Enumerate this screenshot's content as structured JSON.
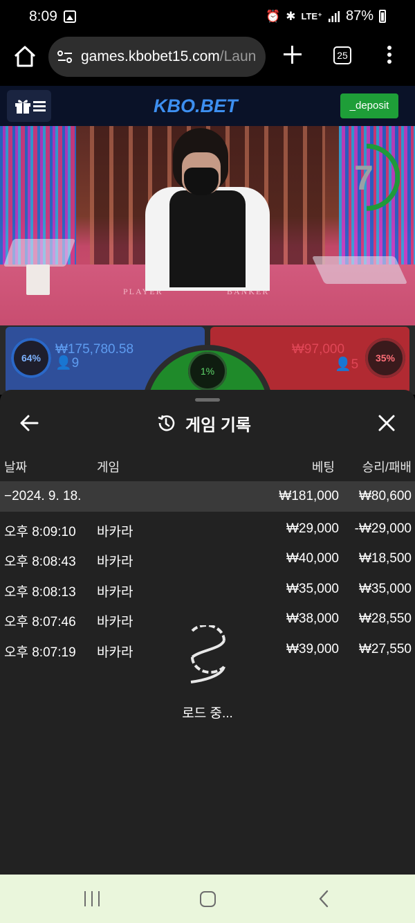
{
  "status_bar": {
    "time": "8:09",
    "lte": "LTE⁺",
    "battery": "87%"
  },
  "browser": {
    "url_main": "games.kbobet15.com",
    "url_rest": "/Laun",
    "tab_count": "25"
  },
  "site": {
    "logo": "KBO.BET",
    "deposit_label": "_deposit"
  },
  "game": {
    "timer": "7",
    "felt_player": "PLAYER",
    "felt_banker": "BANKER",
    "player_pct": "64%",
    "player_amount": "₩175,780.58",
    "player_count": "9",
    "banker_pct": "35%",
    "banker_amount": "₩97,000",
    "banker_count": "5",
    "tie_pct": "1%"
  },
  "history": {
    "title": "게임 기록",
    "headers": {
      "date": "날짜",
      "game": "게임",
      "bet": "베팅",
      "winloss": "승리/패배"
    },
    "summary": {
      "date": "−2024. 9. 18.",
      "bet": "₩181,000",
      "winloss": "₩80,600"
    },
    "rows": [
      {
        "time": "오후 8:09:10",
        "game": "바카라",
        "bet": "₩29,000",
        "winloss": "-₩29,000"
      },
      {
        "time": "오후 8:08:43",
        "game": "바카라",
        "bet": "₩40,000",
        "winloss": "₩18,500"
      },
      {
        "time": "오후 8:08:13",
        "game": "바카라",
        "bet": "₩35,000",
        "winloss": "₩35,000"
      },
      {
        "time": "오후 8:07:46",
        "game": "바카라",
        "bet": "₩38,000",
        "winloss": "₩28,550"
      },
      {
        "time": "오후 8:07:19",
        "game": "바카라",
        "bet": "₩39,000",
        "winloss": "₩27,550"
      }
    ],
    "loading": "로드 중..."
  },
  "colors": {
    "deposit_green": "#1e9e38",
    "logo_blue": "#3d8ff0",
    "player_blue": "#2f4f9a",
    "banker_red": "#b12a32",
    "sheet_bg": "#222222"
  },
  "icons": [
    "gallery-icon",
    "alarm-icon",
    "bluetooth-icon",
    "signal-icon",
    "battery-icon",
    "home-icon",
    "site-settings-icon",
    "new-tab-icon",
    "tabs-icon",
    "more-icon",
    "gift-icon",
    "hamburger-icon",
    "back-arrow-icon",
    "history-icon",
    "close-icon",
    "loading-spinner-icon",
    "recents-icon",
    "nav-home-icon",
    "nav-back-icon"
  ]
}
